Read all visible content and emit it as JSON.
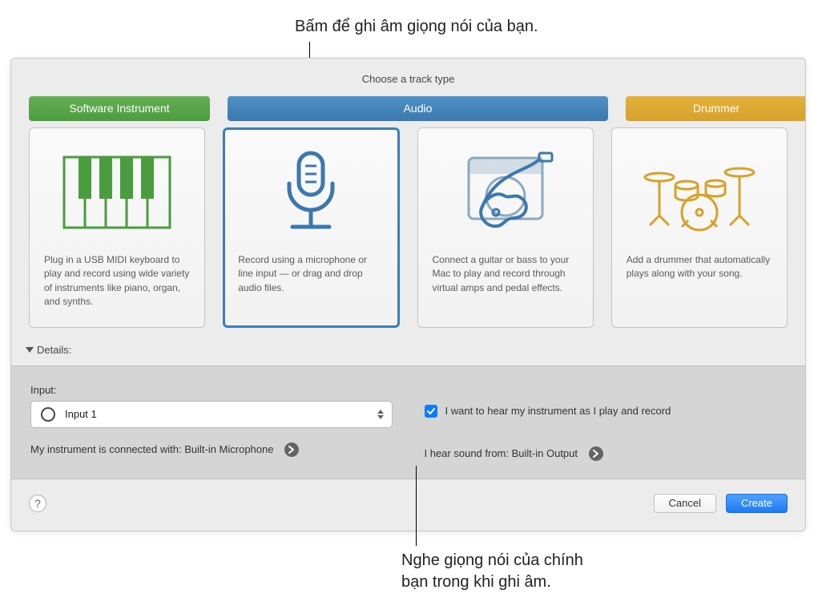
{
  "callouts": {
    "top": "Bấm để ghi âm giọng nói của bạn.",
    "bottom_l1": "Nghe giọng nói của chính",
    "bottom_l2": "bạn trong khi ghi âm."
  },
  "dialog": {
    "title": "Choose a track type",
    "details_label": "Details:"
  },
  "tabs": {
    "si": "Software Instrument",
    "audio": "Audio",
    "drummer": "Drummer"
  },
  "cards": {
    "si": "Plug in a USB MIDI keyboard to play and record using wide variety of instruments like piano, organ, and synths.",
    "mic": "Record using a microphone or line input — or drag and drop audio files.",
    "guitar": "Connect a guitar or bass to your Mac to play and record through virtual amps and pedal effects.",
    "drummer": "Add a drummer that automatically plays along with your song."
  },
  "details": {
    "input_label": "Input:",
    "input_value": "Input 1",
    "connected_prefix": "My instrument is connected with: ",
    "connected_value": "Built-in Microphone",
    "monitor_label": "I want to hear my instrument as I play and record",
    "hear_prefix": "I hear sound from: ",
    "hear_value": "Built-in Output"
  },
  "footer": {
    "cancel": "Cancel",
    "create": "Create",
    "help": "?"
  },
  "colors": {
    "green": "#4a9c3e",
    "blue": "#3a78af",
    "yellow": "#d7a12a",
    "accent": "#1f7bf2"
  }
}
